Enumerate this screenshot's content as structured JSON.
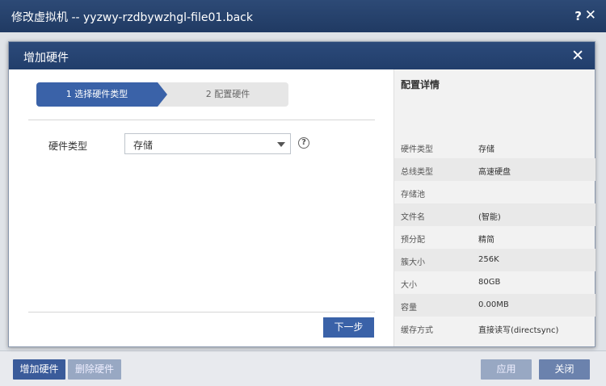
{
  "window": {
    "title": "修改虚拟机 -- yyzwy-rzdbywzhgl-file01.back",
    "help": "?",
    "close": "✕"
  },
  "dialog": {
    "title": "增加硬件",
    "close": "✕"
  },
  "wizard": {
    "step1": "1 选择硬件类型",
    "step2": "2 配置硬件"
  },
  "form": {
    "hardware_type_label": "硬件类型",
    "hardware_type_value": "存储",
    "help": "?"
  },
  "buttons": {
    "next": "下一步",
    "add_hardware": "增加硬件",
    "delete_hardware": "删除硬件",
    "apply": "应用",
    "close": "关闭"
  },
  "details": {
    "header": "配置详情",
    "rows": [
      {
        "key": "硬件类型",
        "value": "存储"
      },
      {
        "key": "总线类型",
        "value": "高速硬盘"
      },
      {
        "key": "存储池",
        "value": ""
      },
      {
        "key": "文件名",
        "value": "(智能)"
      },
      {
        "key": "预分配",
        "value": "精简"
      },
      {
        "key": "簇大小",
        "value": "256K"
      },
      {
        "key": "大小",
        "value": "80GB"
      },
      {
        "key": "容量",
        "value": "0.00MB"
      },
      {
        "key": "缓存方式",
        "value": "直接读写(directsync)"
      }
    ]
  }
}
